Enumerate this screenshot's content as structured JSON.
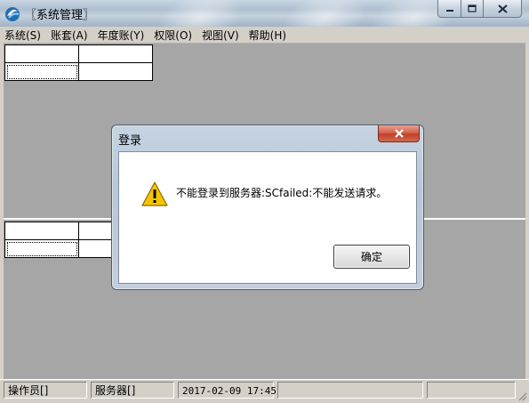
{
  "window": {
    "title": "〖系统管理〗"
  },
  "menu": {
    "items": [
      {
        "label": "系统(S)"
      },
      {
        "label": "账套(A)"
      },
      {
        "label": "年度账(Y)"
      },
      {
        "label": "权限(O)"
      },
      {
        "label": "视图(V)"
      },
      {
        "label": "帮助(H)"
      }
    ]
  },
  "dialog": {
    "title": "登录",
    "message": "不能登录到服务器:SCfailed:不能发送请求。",
    "ok_label": "确定",
    "icon": "warning-icon"
  },
  "statusbar": {
    "operator": "操作员[]",
    "server": "服务器[]",
    "datetime": "2017-02-09 17:45"
  },
  "colors": {
    "workspace": "#a6a6a6",
    "chrome": "#d4d0c8",
    "warning": "#f5c400"
  }
}
